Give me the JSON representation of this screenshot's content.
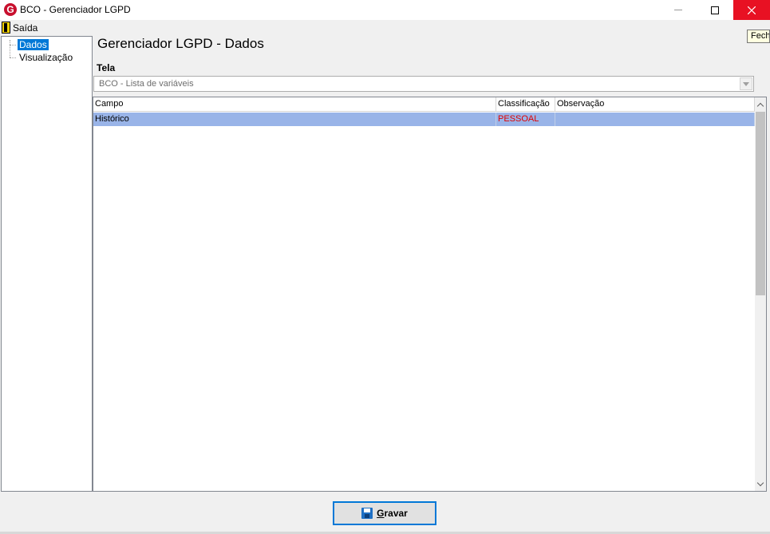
{
  "window": {
    "title": "BCO - Gerenciador LGPD",
    "icon": "app-logo-g-icon"
  },
  "menu": {
    "exit_label": "Saída"
  },
  "tooltip": {
    "text": "Fech"
  },
  "tree": {
    "items": [
      {
        "label": "Dados",
        "selected": true
      },
      {
        "label": "Visualização",
        "selected": false
      }
    ]
  },
  "main": {
    "title": "Gerenciador LGPD - Dados",
    "tela_label": "Tela",
    "tela_value": "BCO - Lista de variáveis"
  },
  "grid": {
    "columns": [
      "Campo",
      "Classificação",
      "Observação"
    ],
    "rows": [
      {
        "campo": "Histórico",
        "classificacao": "PESSOAL",
        "observacao": ""
      }
    ]
  },
  "footer": {
    "save_label": "Gravar",
    "save_mnemonic": "G"
  },
  "colors": {
    "selection": "#0078d7",
    "row_highlight": "#99b4e8",
    "pessoal_text": "#e00000",
    "close_button": "#e81123"
  }
}
